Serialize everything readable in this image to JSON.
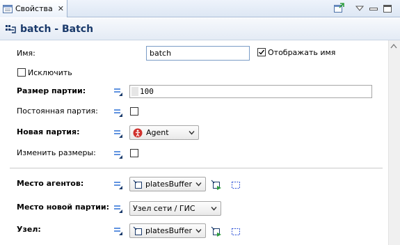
{
  "tab": {
    "label": "Свойства",
    "close": "✕"
  },
  "header": {
    "title": "batch - Batch"
  },
  "fields": {
    "name_label": "Имя:",
    "name_value": "batch",
    "show_name_label": "Отображать имя",
    "show_name_checked": true,
    "exclude_label": "Исключить",
    "exclude_checked": false,
    "batch_size_label": "Размер партии:",
    "batch_size_value": "100",
    "permanent_label": "Постоянная партия:",
    "permanent_checked": false,
    "new_batch_label": "Новая партия:",
    "new_batch_value": "Agent",
    "resize_label": "Изменить размеры:",
    "resize_checked": false,
    "agent_location_label": "Место агентов:",
    "agent_location_value": "platesBuffer",
    "new_batch_location_label": "Место новой партии:",
    "new_batch_location_value": "Узел сети / ГИС",
    "node_label": "Узел:",
    "node_value": "platesBuffer"
  },
  "colors": {
    "accent": "#1a3a6b",
    "field_border": "#7a9cc6",
    "eq_icon": "#2a6fd6",
    "agent_icon": "#d0312d",
    "go_icon": "#2e9e3e"
  },
  "icons": [
    "properties-icon",
    "close-icon",
    "toolbar-icon",
    "menu-icon",
    "minimize-icon",
    "maximize-icon",
    "batch-icon",
    "dynamic-value-icon",
    "agent-icon",
    "dropdown-arrow-icon",
    "go-to-icon",
    "select-icon"
  ]
}
